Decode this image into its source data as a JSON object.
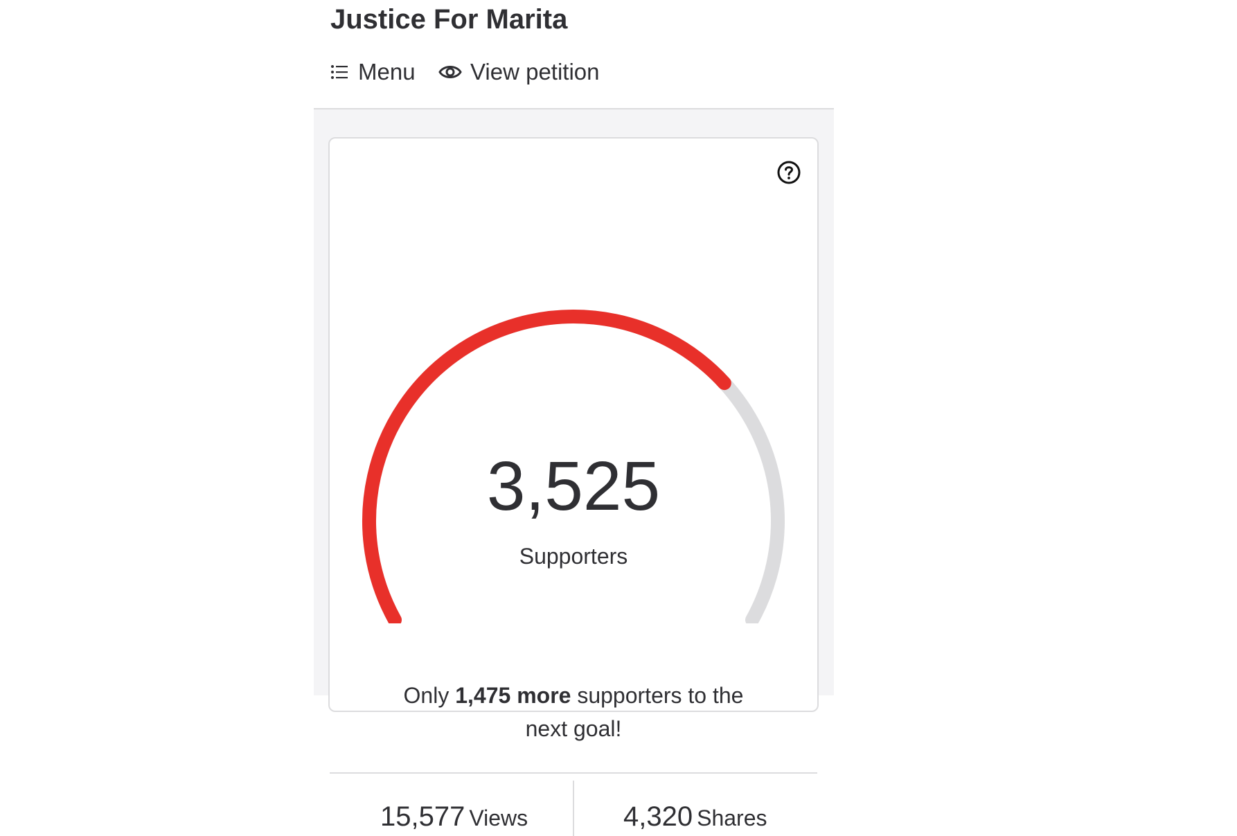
{
  "header": {
    "title": "Justice For Marita",
    "menu_label": "Menu",
    "view_petition_label": "View petition",
    "menu_icon": "list-icon",
    "view_icon": "eye-icon"
  },
  "card": {
    "help_icon": "help-circle-icon",
    "supporters_count": "3,525",
    "supporters_label": "Supporters",
    "progress_fraction": 0.7,
    "goal_prefix": "Only ",
    "goal_bold": "1,475 more",
    "goal_suffix": " supporters to the next goal!",
    "colors": {
      "progress": "#e8302a",
      "track": "#dcdcde"
    }
  },
  "stats": {
    "views_value": "15,577",
    "views_label": "Views",
    "shares_value": "4,320",
    "shares_label": "Shares"
  }
}
